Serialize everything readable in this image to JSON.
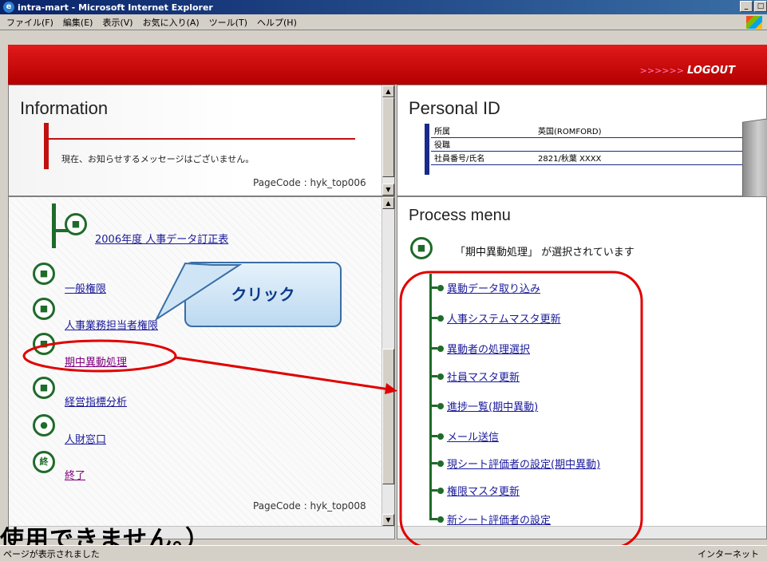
{
  "window": {
    "title": "intra-mart - Microsoft Internet Explorer"
  },
  "menubar": [
    "ファイル(F)",
    "編集(E)",
    "表示(V)",
    "お気に入り(A)",
    "ツール(T)",
    "ヘルプ(H)"
  ],
  "banner": {
    "arrows": ">>>>>>",
    "logout": "LOGOUT"
  },
  "information": {
    "title": "Information",
    "message": "現在、お知らせするメッセージはございません。",
    "pagecode": "PageCode : hyk_top006"
  },
  "personal": {
    "title": "Personal ID",
    "rows": [
      {
        "label": "所属",
        "value": "英国(ROMFORD)"
      },
      {
        "label": "役職",
        "value": ""
      },
      {
        "label": "社員番号/氏名",
        "value": "2821/秋葉 XXXX"
      }
    ]
  },
  "left_menu": {
    "top_item": "2006年度 人事データ訂正表",
    "items": [
      "一般権限",
      "人事業務担当者権限",
      "期中異動処理",
      "経営指標分析",
      "人財窓口",
      "終了"
    ],
    "pagecode": "PageCode : hyk_top008"
  },
  "process_menu": {
    "title": "Process menu",
    "selected_text": "「期中異動処理」 が選択されています",
    "items": [
      "異動データ取り込み",
      "人事システムマスタ更新",
      "異動者の処理選択",
      "社員マスタ更新",
      "進捗一覧(期中異動)",
      "メール送信",
      "現シート評価者の設定(期中異動)",
      "権限マスタ更新",
      "新シート評価者の設定"
    ]
  },
  "callout": {
    "text": "クリック"
  },
  "caption": {
    "text": "使用できません。）"
  },
  "statusbar": {
    "text": "ページが表示されました",
    "zone": "インターネット"
  },
  "colors": {
    "banner": "#c8000a",
    "highlight": "#e00000",
    "tree": "#1f6b2a"
  }
}
